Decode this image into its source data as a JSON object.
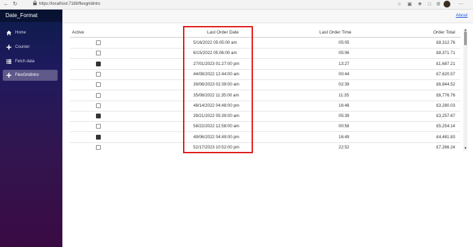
{
  "browser": {
    "url": "https://localhost:7188/flexgridintro",
    "icons": [
      "back-icon",
      "reload-icon",
      "lock-icon",
      "favorites-icon",
      "tab-icon",
      "collections-icon",
      "extensions-icon",
      "settings-icon"
    ]
  },
  "sidebar": {
    "brand": "Date_Format",
    "items": [
      {
        "label": "Home",
        "icon": "home-icon",
        "active": false
      },
      {
        "label": "Counter",
        "icon": "plus-icon",
        "active": false
      },
      {
        "label": "Fetch data",
        "icon": "list-icon",
        "active": false
      },
      {
        "label": "FlexGridIntro",
        "icon": "plus-icon",
        "active": true
      }
    ]
  },
  "topbar": {
    "about": "About"
  },
  "grid": {
    "headers": {
      "active": "Active",
      "last_order_date": "Last Order Date",
      "last_order_time": "Last Order Time",
      "order_total": "Order Total"
    },
    "rows": [
      {
        "active": false,
        "date": "5/16/2022 05:05:00 am",
        "time": "05:05",
        "total": "£8,312.76"
      },
      {
        "active": false,
        "date": "6/15/2022 05:06:00 am",
        "time": "05:06",
        "total": "£8,371.71"
      },
      {
        "active": true,
        "date": "27/01/2023 01:27:00 pm",
        "time": "13:27",
        "total": "£1,687.21"
      },
      {
        "active": false,
        "date": "44/08/2022 12:44:00 am",
        "time": "00:44",
        "total": "£7,620.57"
      },
      {
        "active": false,
        "date": "39/06/2023 02:39:00 am",
        "time": "02:39",
        "total": "£6,844.52"
      },
      {
        "active": false,
        "date": "35/08/2022 11:35:00 am",
        "time": "11:35",
        "total": "£6,776.76"
      },
      {
        "active": false,
        "date": "48/14/2022 04:48:00 pm",
        "time": "16:48",
        "total": "£3,280.03"
      },
      {
        "active": true,
        "date": "39/21/2022 05:39:00 am",
        "time": "05:39",
        "total": "£3,257.67"
      },
      {
        "active": false,
        "date": "58/22/2022 12:58:00 am",
        "time": "00:58",
        "total": "£5,254.14"
      },
      {
        "active": true,
        "date": "49/06/2022 04:49:00 pm",
        "time": "16:49",
        "total": "£4,481.83"
      },
      {
        "active": false,
        "date": "52/17/2023 10:52:00 pm",
        "time": "22:52",
        "total": "£7,266.24"
      }
    ]
  },
  "colors": {
    "highlight": "#e01b1b",
    "link": "#1a56db"
  }
}
